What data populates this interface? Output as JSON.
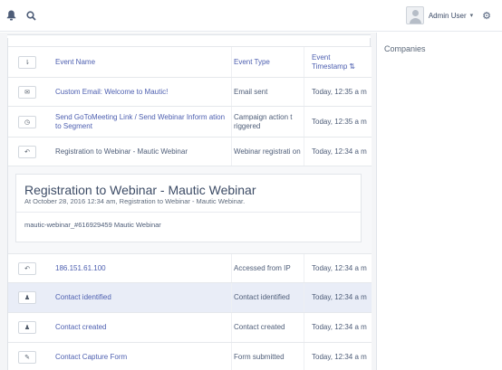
{
  "topbar": {
    "notifications_icon": "bell-icon",
    "search_icon": "search-icon",
    "user_name": "Admin User",
    "user_caret": "▾",
    "settings_icon": "gear-icon"
  },
  "right_panel": {
    "title": "Companies"
  },
  "table": {
    "headers": {
      "toggle": "⇂",
      "event_name": "Event Name",
      "event_type": "Event Type",
      "timestamp": "Event Timestamp",
      "sort_icon": "⇅"
    },
    "rows": [
      {
        "icon": "envelope-icon",
        "glyph": "✉",
        "name": "Custom Email: Welcome to Mautic!",
        "type": "Email sent",
        "time": "Today, 12:35 a m"
      },
      {
        "icon": "clock-icon",
        "glyph": "◷",
        "name": "Send GoToMeeting Link / Send Webinar Inform ation to Segment",
        "type": "Campaign action t riggered",
        "time": "Today, 12:35 a m"
      },
      {
        "icon": "undo-icon",
        "glyph": "↶",
        "name": "Registration to Webinar - Mautic Webinar",
        "type": "Webinar registrati on",
        "time": "Today, 12:34 a m"
      }
    ],
    "detail": {
      "title": "Registration to Webinar - Mautic Webinar",
      "subtitle": "At October 28, 2016 12:34 am, Registration to Webinar - Mautic Webinar.",
      "body": "mautic-webinar_#616929459 Mautic Webinar"
    },
    "rows_after": [
      {
        "icon": "undo-icon",
        "glyph": "↶",
        "name": "186.151.61.100",
        "type": "Accessed from IP",
        "time": "Today, 12:34 a m",
        "highlight": false
      },
      {
        "icon": "user-icon",
        "glyph": "♟",
        "name": "Contact identified",
        "type": "Contact identified",
        "time": "Today, 12:34 a m",
        "highlight": true
      },
      {
        "icon": "user-icon",
        "glyph": "♟",
        "name": "Contact created",
        "type": "Contact created",
        "time": "Today, 12:34 a m",
        "highlight": false
      },
      {
        "icon": "edit-icon",
        "glyph": "✎",
        "name": "Contact Capture Form",
        "type": "Form submitted",
        "time": "Today, 12:34 a m",
        "highlight": false
      }
    ]
  },
  "colors": {
    "link": "#4d5fb0",
    "highlight_row": "#e9edf7",
    "panel_bg": "#f4f5f7"
  }
}
